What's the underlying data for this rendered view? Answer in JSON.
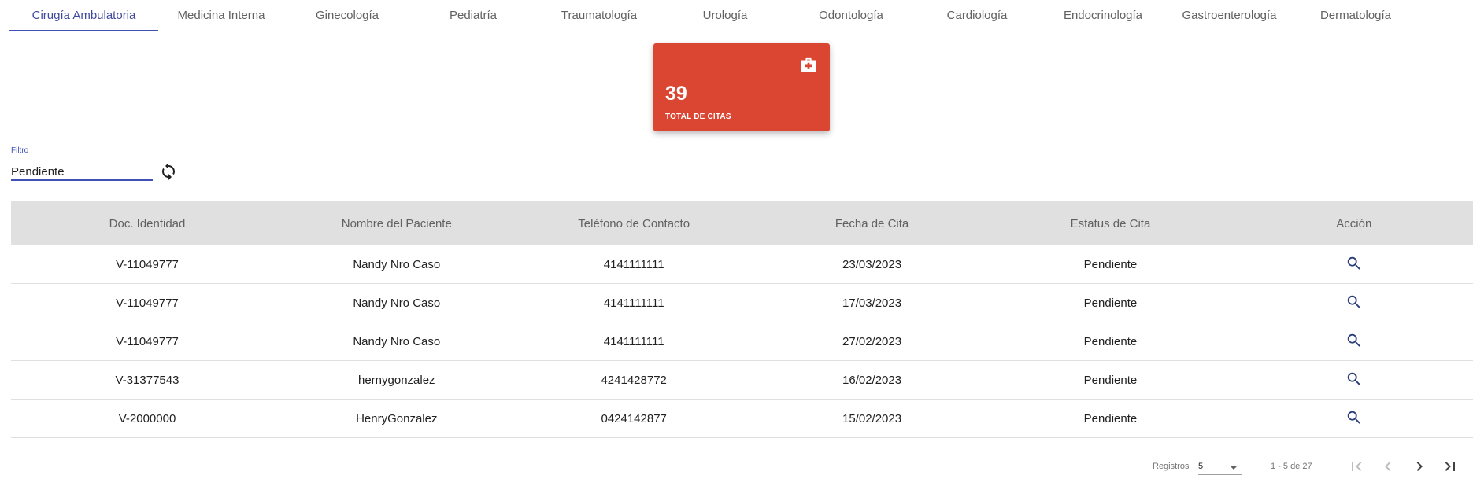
{
  "tabs": [
    {
      "label": "Cirugía Ambulatoria",
      "active": true
    },
    {
      "label": "Medicina Interna",
      "active": false
    },
    {
      "label": "Ginecología",
      "active": false
    },
    {
      "label": "Pediatría",
      "active": false
    },
    {
      "label": "Traumatología",
      "active": false
    },
    {
      "label": "Urología",
      "active": false
    },
    {
      "label": "Odontología",
      "active": false
    },
    {
      "label": "Cardiología",
      "active": false
    },
    {
      "label": "Endocrinología",
      "active": false
    },
    {
      "label": "Gastroenterología",
      "active": false
    },
    {
      "label": "Dermatología",
      "active": false
    }
  ],
  "stat_card": {
    "value": "39",
    "label": "TOTAL DE CITAS",
    "icon": "medical-kit-icon",
    "color": "#db4632"
  },
  "filter": {
    "label": "Filtro",
    "value": "Pendiente",
    "refresh_icon": "refresh-icon"
  },
  "table": {
    "headers": [
      "Doc. Identidad",
      "Nombre del Paciente",
      "Teléfono de Contacto",
      "Fecha de Cita",
      "Estatus de Cita",
      "Acción"
    ],
    "rows": [
      {
        "doc": "V-11049777",
        "name": "Nandy Nro Caso",
        "phone": "4141111111",
        "date": "23/03/2023",
        "status": "Pendiente"
      },
      {
        "doc": "V-11049777",
        "name": "Nandy Nro Caso",
        "phone": "4141111111",
        "date": "17/03/2023",
        "status": "Pendiente"
      },
      {
        "doc": "V-11049777",
        "name": "Nandy Nro Caso",
        "phone": "4141111111",
        "date": "27/02/2023",
        "status": "Pendiente"
      },
      {
        "doc": "V-31377543",
        "name": "hernygonzalez",
        "phone": "4241428772",
        "date": "16/02/2023",
        "status": "Pendiente"
      },
      {
        "doc": "V-2000000",
        "name": "HenryGonzalez",
        "phone": "0424142877",
        "date": "15/02/2023",
        "status": "Pendiente"
      }
    ],
    "action_icon": "search-icon"
  },
  "paginator": {
    "page_size_label": "Registros",
    "page_size": "5",
    "range": "1 - 5 de 27"
  },
  "colors": {
    "primary": "#3f51b5",
    "header_bg": "#e0e0e0",
    "card": "#db4632"
  }
}
